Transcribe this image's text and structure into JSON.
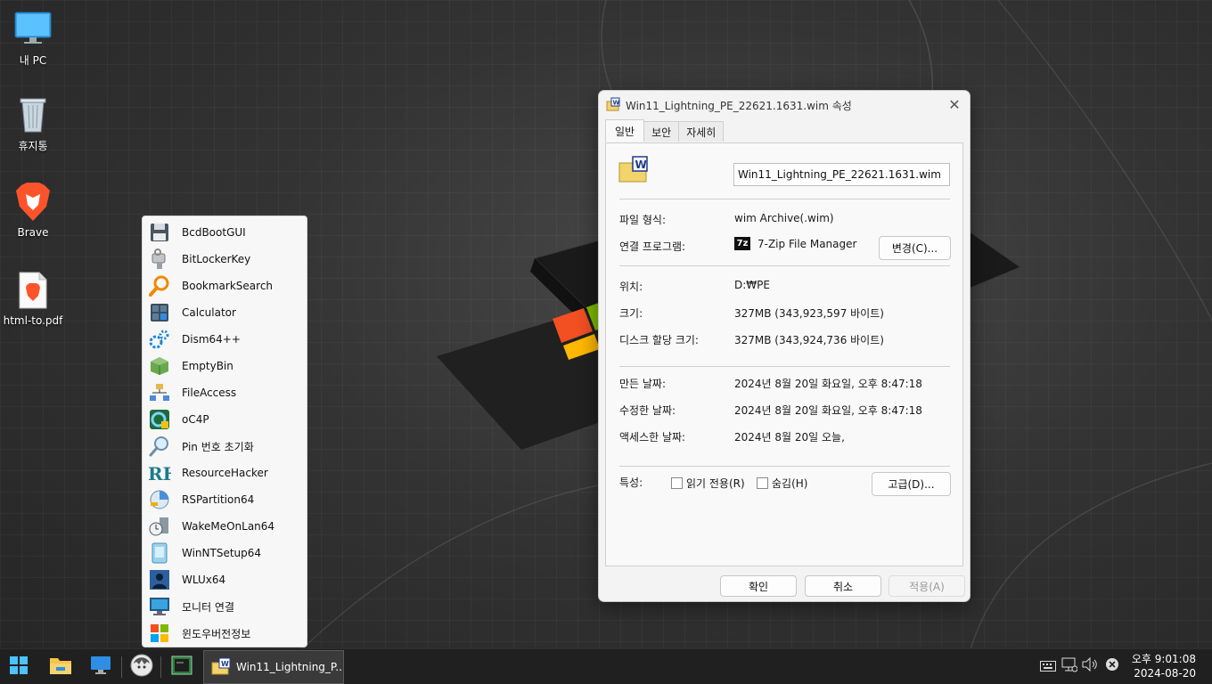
{
  "desktop": {
    "icons": [
      {
        "label": "내 PC",
        "icon": "monitor-icon"
      },
      {
        "label": "휴지통",
        "icon": "recycle-bin-icon"
      },
      {
        "label": "Brave",
        "icon": "brave-lion-icon"
      },
      {
        "label": "html-to.pdf",
        "icon": "pdf-file-icon"
      }
    ]
  },
  "launcher": {
    "items": [
      {
        "label": "BcdBootGUI",
        "icon": "floppy-disk-icon"
      },
      {
        "label": "BitLockerKey",
        "icon": "key-usb-icon"
      },
      {
        "label": "BookmarkSearch",
        "icon": "magnifier-orange-icon"
      },
      {
        "label": "Calculator",
        "icon": "calculator-icon"
      },
      {
        "label": "Dism64++",
        "icon": "gears-icon"
      },
      {
        "label": "EmptyBin",
        "icon": "green-box-icon"
      },
      {
        "label": "FileAccess",
        "icon": "network-folders-icon"
      },
      {
        "label": "oC4P",
        "icon": "oc4p-icon"
      },
      {
        "label": "Pin 번호 초기화",
        "icon": "magnifier-icon"
      },
      {
        "label": "ResourceHacker",
        "icon": "rh-logo-icon"
      },
      {
        "label": "RSPartition64",
        "icon": "partition-icon"
      },
      {
        "label": "WakeMeOnLan64",
        "icon": "clock-computer-icon"
      },
      {
        "label": "WinNTSetup64",
        "icon": "installer-icon"
      },
      {
        "label": "WLUx64",
        "icon": "users-icon"
      },
      {
        "label": "모니터 연결",
        "icon": "monitor-connect-icon"
      },
      {
        "label": "윈도우버전정보",
        "icon": "windows-logo-icon"
      }
    ]
  },
  "dialog": {
    "title": "Win11_Lightning_PE_22621.1631.wim 속성",
    "tabs": [
      "일반",
      "보안",
      "자세히"
    ],
    "file_name": "Win11_Lightning_PE_22621.1631.wim",
    "type_label": "파일 형식:",
    "type_value": "wim Archive(.wim)",
    "opens_label": "연결 프로그램:",
    "opens_value": "7-Zip File Manager",
    "change_button": "변경(C)...",
    "location_label": "위치:",
    "location_value": "D:₩PE",
    "size_label": "크기:",
    "size_value": "327MB (343,923,597 바이트)",
    "disk_size_label": "디스크 할당 크기:",
    "disk_size_value": "327MB (343,924,736 바이트)",
    "created_label": "만든 날짜:",
    "created_value": "2024년 8월 20일 화요일, 오후 8:47:18",
    "modified_label": "수정한 날짜:",
    "modified_value": "2024년 8월 20일 화요일, 오후 8:47:18",
    "accessed_label": "액세스한 날짜:",
    "accessed_value": "2024년 8월 20일 오늘,",
    "attributes_label": "특성:",
    "readonly_label": "읽기 전용(R)",
    "hidden_label": "숨김(H)",
    "advanced_button": "고급(D)...",
    "ok_button": "확인",
    "cancel_button": "취소",
    "apply_button": "적용(A)",
    "seven_zip_badge": "7z"
  },
  "taskbar": {
    "task_label": "Win11_Lightning_P...",
    "clock_time": "오후 9:01:08",
    "clock_date": "2024-08-20"
  },
  "colors": {
    "taskbar": "#202020",
    "dialog_bg": "#f3f3f3",
    "accent_blue": "#1e88e5"
  }
}
